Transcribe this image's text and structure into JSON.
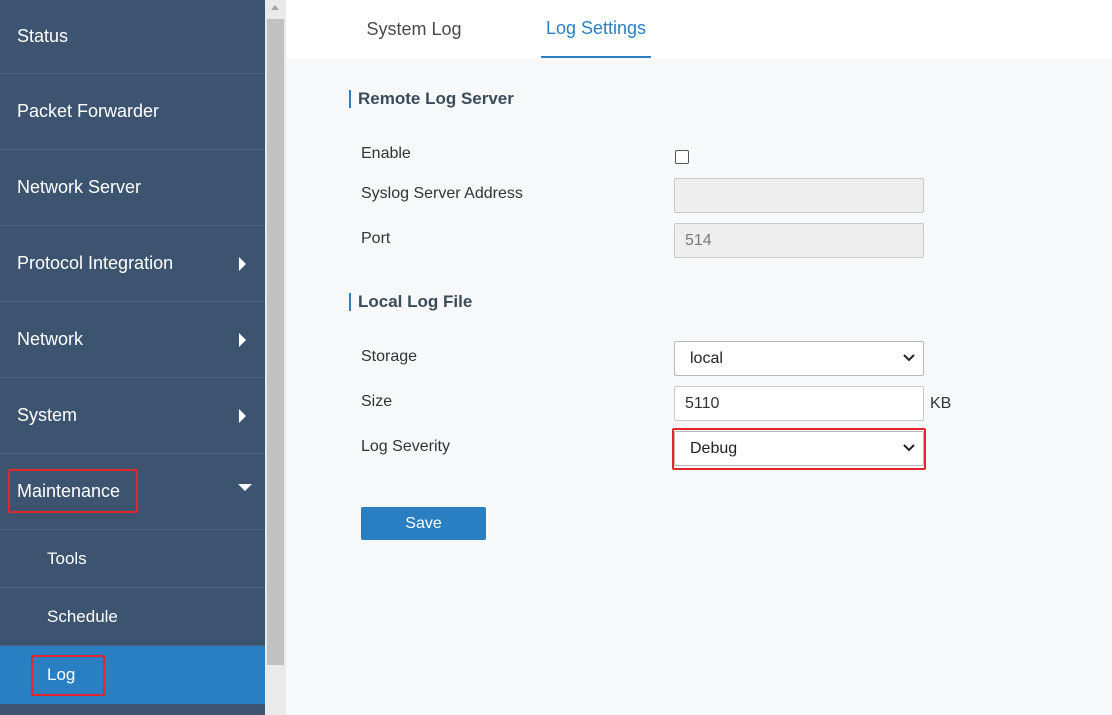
{
  "sidebar": {
    "items": [
      {
        "label": "Status"
      },
      {
        "label": "Packet Forwarder"
      },
      {
        "label": "Network Server"
      },
      {
        "label": "Protocol Integration"
      },
      {
        "label": "Network"
      },
      {
        "label": "System"
      },
      {
        "label": "Maintenance"
      }
    ],
    "subitems": [
      {
        "label": "Tools"
      },
      {
        "label": "Schedule"
      },
      {
        "label": "Log"
      }
    ]
  },
  "tabs": [
    {
      "label": "System Log"
    },
    {
      "label": "Log Settings"
    }
  ],
  "remote": {
    "title": "Remote Log Server",
    "enable_label": "Enable",
    "address_label": "Syslog Server Address",
    "address_value": "",
    "port_label": "Port",
    "port_value": "514"
  },
  "local": {
    "title": "Local Log File",
    "storage_label": "Storage",
    "storage_value": "local",
    "size_label": "Size",
    "size_value": "5110",
    "size_unit": "KB",
    "severity_label": "Log Severity",
    "severity_value": "Debug"
  },
  "save_label": "Save",
  "colors": {
    "sidebar": "#3d5470",
    "accent": "#2a7fc3",
    "highlight": "#e3262b"
  }
}
